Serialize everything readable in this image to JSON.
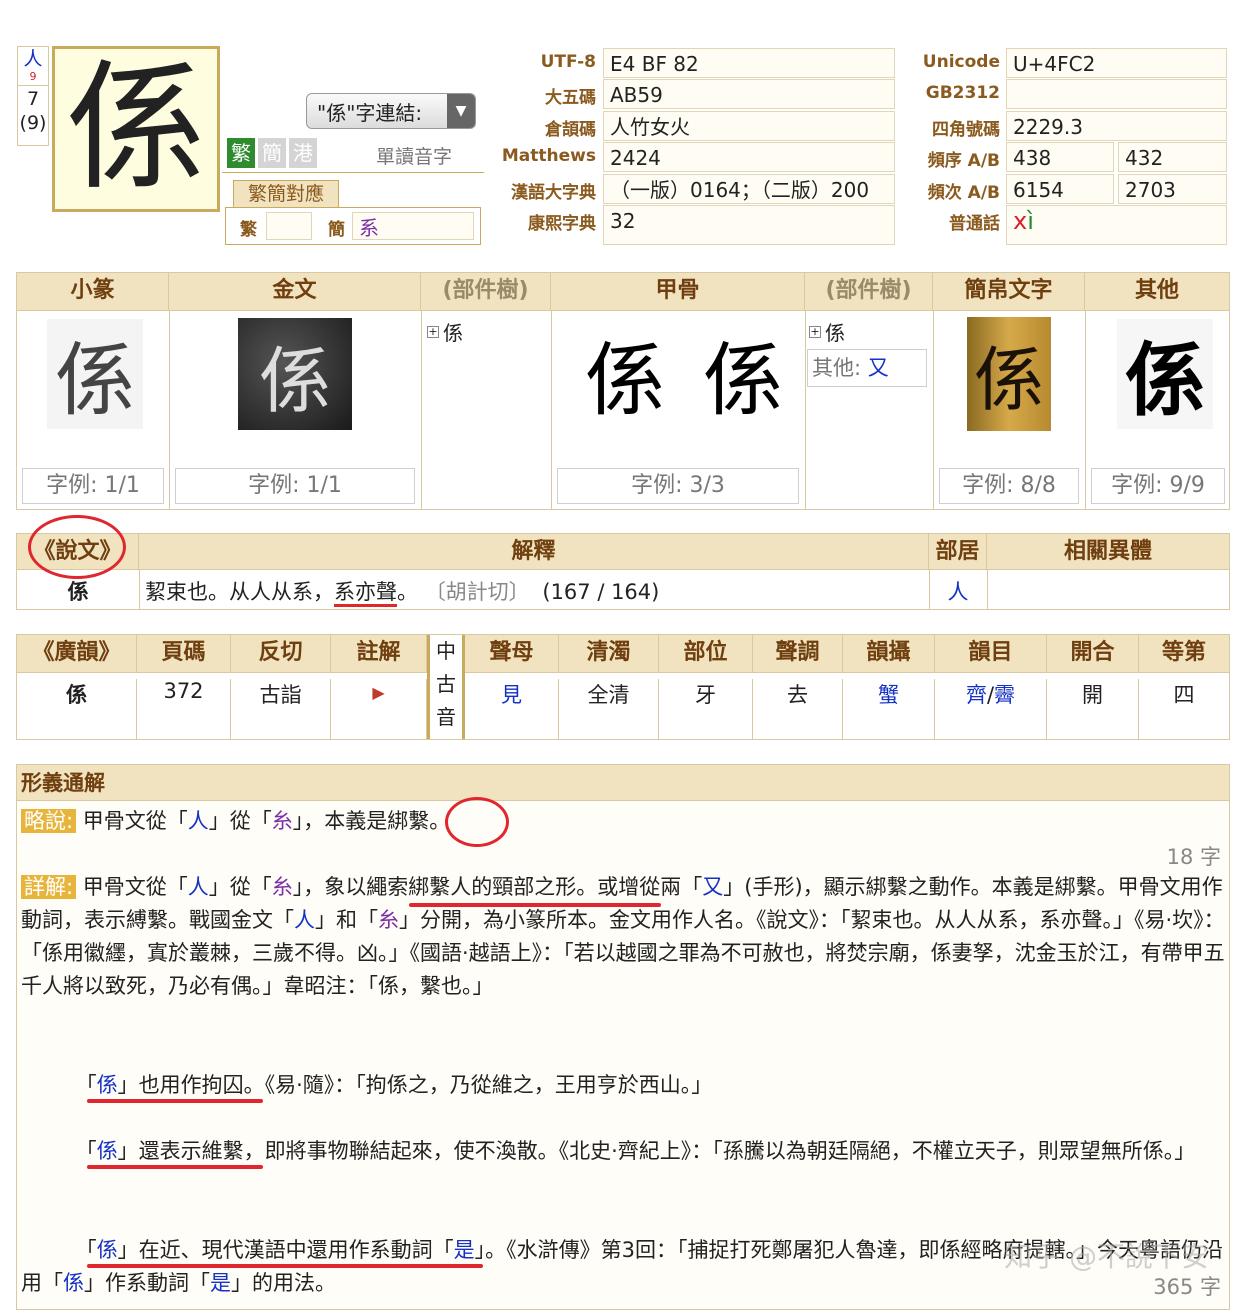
{
  "char_box": {
    "char": "係",
    "radical": "人",
    "radical_strokes": "9",
    "strokes": "7",
    "strokes_total": "(9)"
  },
  "link_dropdown": {
    "label": "\"係\"字連結:"
  },
  "variant_tabs": {
    "trad": "繁",
    "simp": "簡",
    "hk": "港",
    "reading": "單讀音字"
  },
  "mapping": {
    "title": "繁簡對應",
    "trad_label": "繁",
    "trad_value": "",
    "simp_label": "簡",
    "simp_value": "系"
  },
  "codes_left": [
    {
      "label": "UTF-8",
      "value": "E4 BF 82"
    },
    {
      "label": "大五碼",
      "value": "AB59"
    },
    {
      "label": "倉頡碼",
      "value": "人竹女火"
    },
    {
      "label": "Matthews",
      "value": "2424"
    },
    {
      "label": "漢語大字典",
      "value": "（一版）0164；（二版）200"
    },
    {
      "label": "康熙字典",
      "value": "32"
    }
  ],
  "codes_right": {
    "unicode": {
      "label": "Unicode",
      "value": "U+4FC2"
    },
    "gb2312": {
      "label": "GB2312",
      "value": ""
    },
    "four_corner": {
      "label": "四角號碼",
      "value": "2229.3"
    },
    "freq_order": {
      "label": "頻序 A/B",
      "a": "438",
      "b": "432"
    },
    "freq_count": {
      "label": "頻次 A/B",
      "a": "6154",
      "b": "2703"
    },
    "putonghua": {
      "label": "普通話",
      "initial": "x",
      "final": "ì"
    }
  },
  "scripts": {
    "headers": [
      "小篆",
      "金文",
      "(部件樹)",
      "甲骨",
      "(部件樹)",
      "簡帛文字",
      "其他"
    ],
    "tree1_char": "係",
    "tree2_char": "係",
    "tree2_other_label": "其他:",
    "tree2_other_value": "又",
    "captions": [
      "字例: 1/1",
      "字例: 1/1",
      "字例: 3/3",
      "字例: 8/8",
      "字例: 9/9"
    ]
  },
  "shuowen": {
    "headers": [
      "《說文》",
      "解釋",
      "部居",
      "相關異體"
    ],
    "char": "係",
    "text1": "絜束也。从人从系，",
    "text2": "系亦聲",
    "text3": "。",
    "fanqie": "〔胡計切〕",
    "pages": "(167 / 164)",
    "radical": "人"
  },
  "guangyun": {
    "headers": [
      "《廣韻》",
      "頁碼",
      "反切",
      "註解"
    ],
    "middle_label": [
      "中",
      "古",
      "音"
    ],
    "mc_headers": [
      "聲母",
      "清濁",
      "部位",
      "聲調",
      "韻攝",
      "韻目",
      "開合",
      "等第"
    ],
    "row": {
      "char": "係",
      "page": "372",
      "fanqie": "古詣",
      "initial": "見",
      "voicing": "全清",
      "place": "牙",
      "tone": "去",
      "rhyme_group": "蟹",
      "rhyme_a": "齊",
      "rhyme_sep": "/",
      "rhyme_b": "霽",
      "openness": "開",
      "grade": "四"
    }
  },
  "xingyi": {
    "title": "形義通解",
    "brief_label": "略說:",
    "brief": [
      "甲骨文從「",
      "人",
      "」從「",
      "糸",
      "」，本義是綁繫。"
    ],
    "brief_count": "18 字",
    "detail_label": "詳解:",
    "detail_p1": [
      "甲骨文從「",
      "人",
      "」從「",
      "糸",
      "」，象以繩索綁繫人的頸部之形。或增從兩「",
      "又",
      "」(手形)，顯示綁繫之動作。本義是綁繫。甲骨文用作動詞，表示縛繫。戰國金文「",
      "人",
      "」和「",
      "糸",
      "」分開，為小篆所本。金文用作人名。《說文》：「絜束也。从人从系，系亦聲。」《易·坎》：「係用徽纆，寘於叢棘，三歲不得。凶。」《國語·越語上》：「若以越國之罪為不可赦也，將焚宗廟，係妻孥，沈金玉於江，有帶甲五千人將以致死，乃必有偶。」韋昭注：「係，繫也。」"
    ],
    "detail_p2": [
      "「",
      "係",
      "」也用作拘囚。《易·隨》：「拘係之，乃從維之，王用亨於西山。」"
    ],
    "detail_p3": [
      "「",
      "係",
      "」還表示維繫，即將事物聯結起來，使不渙散。《北史·齊紀上》：「孫騰以為朝廷隔絕，不權立天子，則眾望無所係。」"
    ],
    "detail_p4": [
      "「",
      "係",
      "」在近、現代漢語中還用作系動詞「",
      "是",
      "」。《水滸傳》第3回：「捕捉打死鄭屠犯人魯達，即係經略府提轄。」今天粵語仍沿用「",
      "係",
      "」作系動詞「",
      "是",
      "」的用法。"
    ],
    "detail_count": "365 字"
  },
  "watermark": "知乎 @不說下安"
}
